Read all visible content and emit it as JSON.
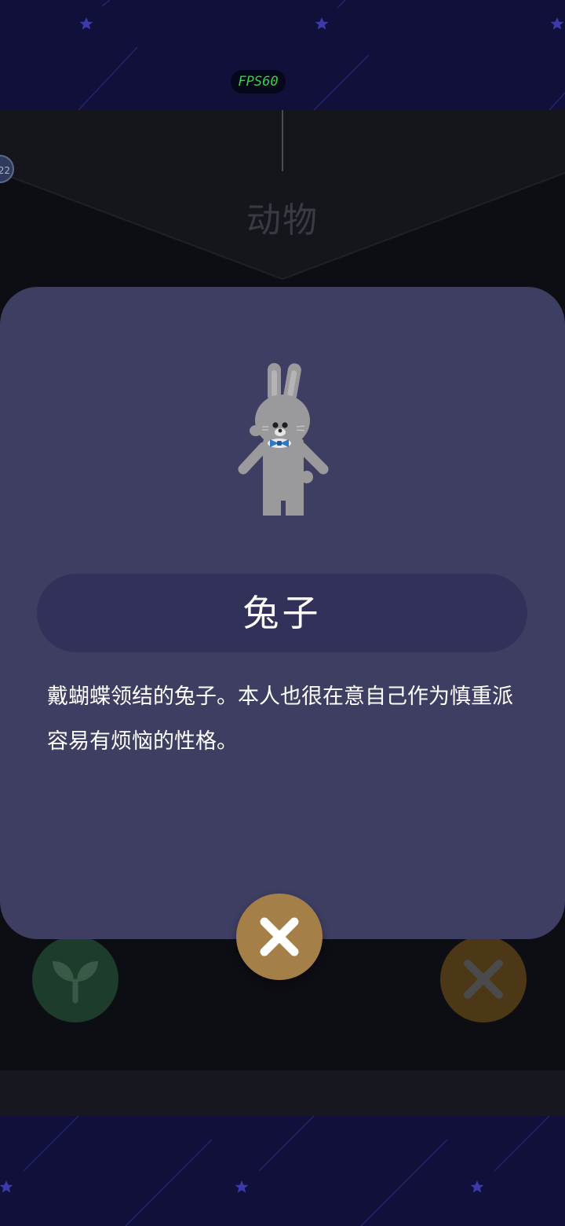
{
  "hud": {
    "fps_label": "FPS60"
  },
  "background": {
    "category_title": "动物",
    "level_badge": "22",
    "left_button_icon": "sprout-icon",
    "right_button_icon": "close-icon"
  },
  "modal": {
    "art_icon": "rabbit-with-bowtie-illustration",
    "name": "兔子",
    "description": "戴蝴蝶领结的兔子。本人也很在意自己作为慎重派容易有烦恼的性格。",
    "close_icon": "close-icon"
  },
  "colors": {
    "sky": "#10103a",
    "modal_bg": "#3e3e63",
    "name_pill_bg": "#31315a",
    "close_button": "#a47f48",
    "fps_green": "#36d04a",
    "bowtie_blue": "#2f78c4",
    "rabbit_gray": "#9a9a9c"
  }
}
